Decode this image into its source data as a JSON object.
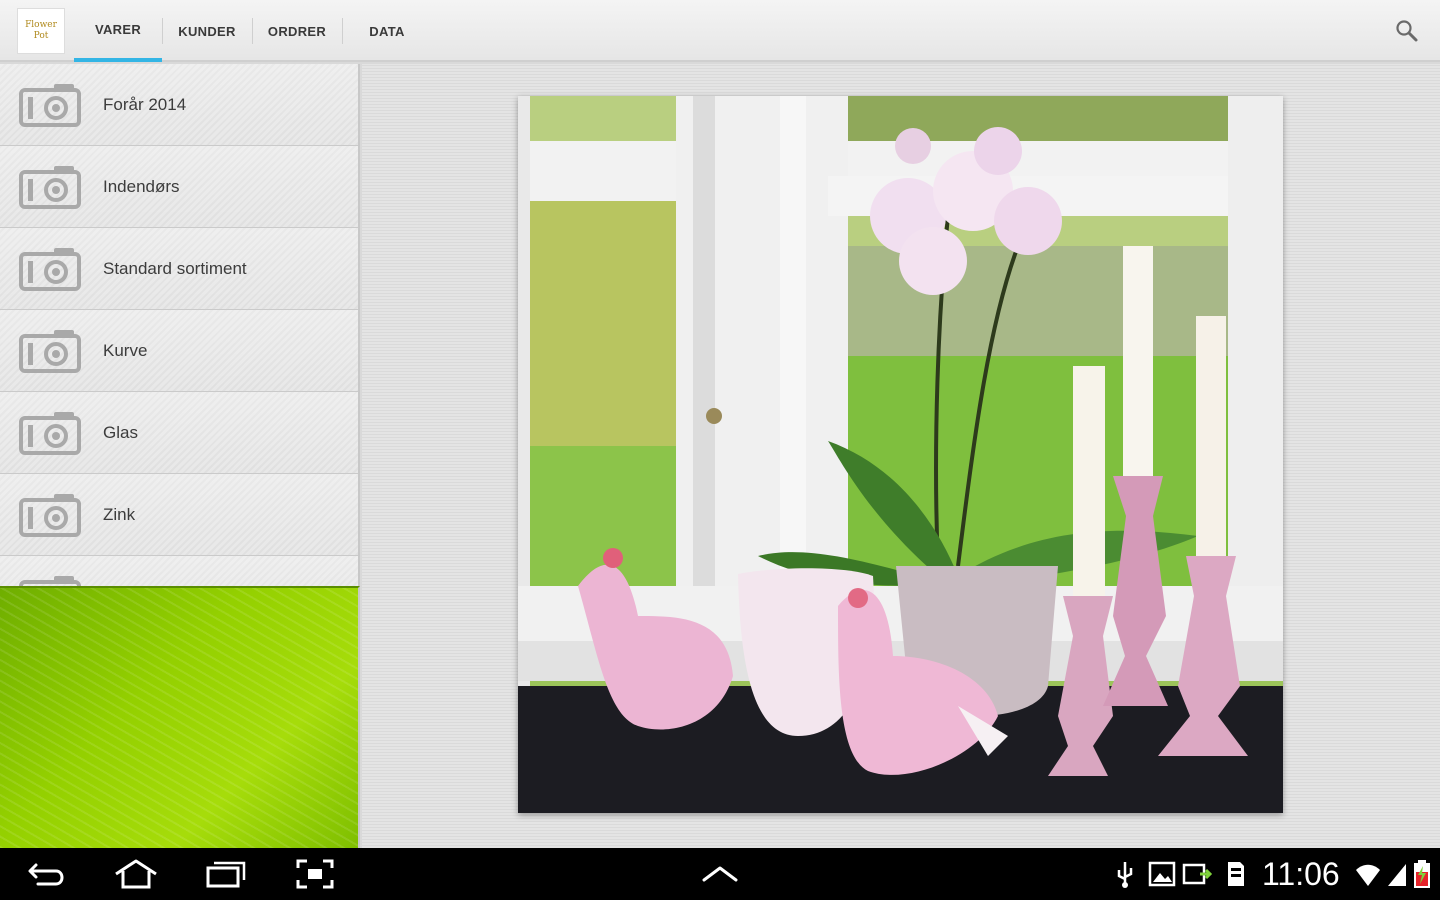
{
  "app": {
    "logo_line1": "Flower",
    "logo_line2": "Pot"
  },
  "tabs": [
    {
      "label": "VARER",
      "active": true
    },
    {
      "label": "KUNDER",
      "active": false
    },
    {
      "label": "ORDRER",
      "active": false
    },
    {
      "label": "DATA",
      "active": false
    }
  ],
  "sidebar": {
    "items": [
      {
        "label": "Forår 2014",
        "icon": "camera-icon"
      },
      {
        "label": "Indendørs",
        "icon": "camera-icon"
      },
      {
        "label": "Standard sortiment",
        "icon": "camera-icon"
      },
      {
        "label": "Kurve",
        "icon": "camera-icon"
      },
      {
        "label": "Glas",
        "icon": "camera-icon"
      },
      {
        "label": "Zink",
        "icon": "camera-icon"
      },
      {
        "label": "",
        "icon": "camera-icon"
      }
    ]
  },
  "statusbar": {
    "time": "11:06"
  },
  "colors": {
    "accent": "#33b5e5",
    "leaf_green": "#94d000"
  }
}
